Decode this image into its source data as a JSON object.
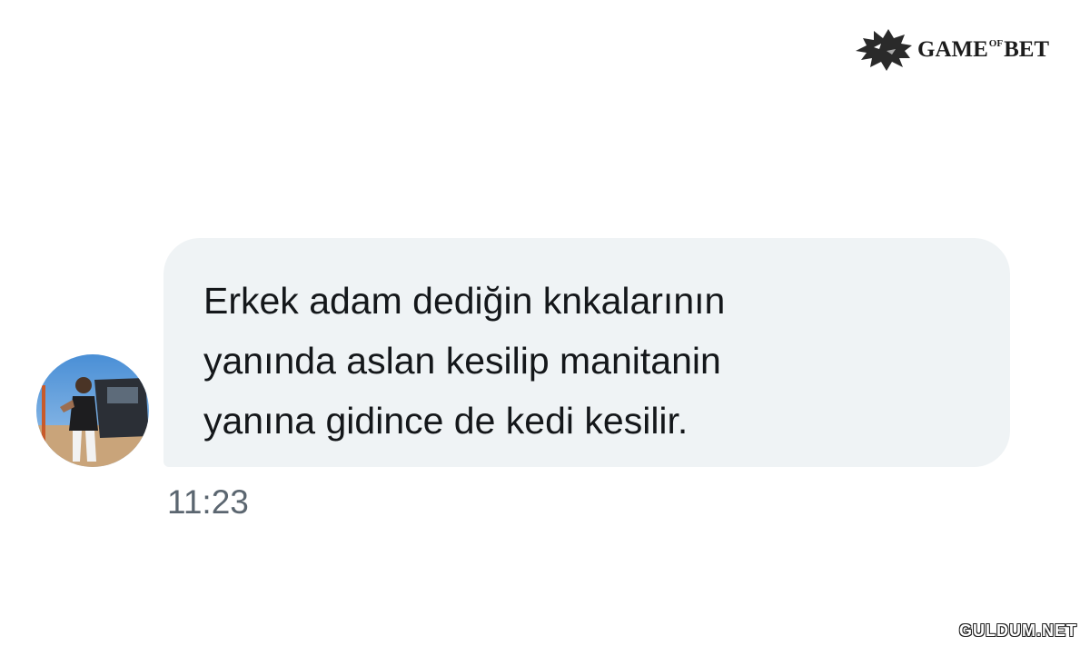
{
  "brand": {
    "logo_icon": "wolf-head-icon",
    "name": "GAME",
    "connector": "OF",
    "suffix": "BET"
  },
  "message": {
    "text": "Erkek adam dediğin knkalarının\nyanında aslan kesilip manitanin\nyanına gidince de kedi kesilir.",
    "time": "11:23",
    "bubble_color": "#eff3f5",
    "text_color": "#14171a"
  },
  "watermark": {
    "text": "GULDUM.NET"
  }
}
